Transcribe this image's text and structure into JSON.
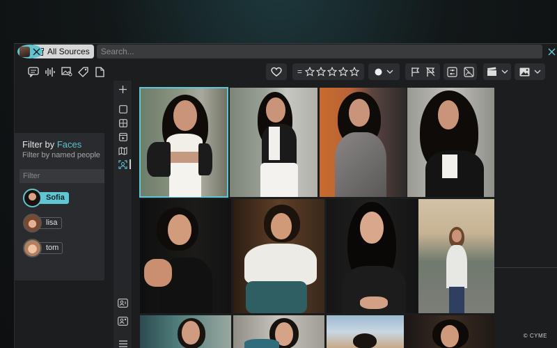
{
  "search": {
    "sources_chip": "All Sources",
    "placeholder": "Search..."
  },
  "filter_panel": {
    "title_prefix": "Filter by ",
    "title_accent": "Faces",
    "subtitle": "Filter by named people",
    "filter_placeholder": "Filter",
    "people": [
      {
        "name": "Sofia",
        "active": true
      },
      {
        "name": "lisa",
        "active": false
      },
      {
        "name": "tom",
        "active": false
      }
    ]
  },
  "colors": {
    "accent": "#5fc6d4",
    "panel": "#2a2b2e",
    "background": "#1c1d1f"
  },
  "credit": "© CYME"
}
